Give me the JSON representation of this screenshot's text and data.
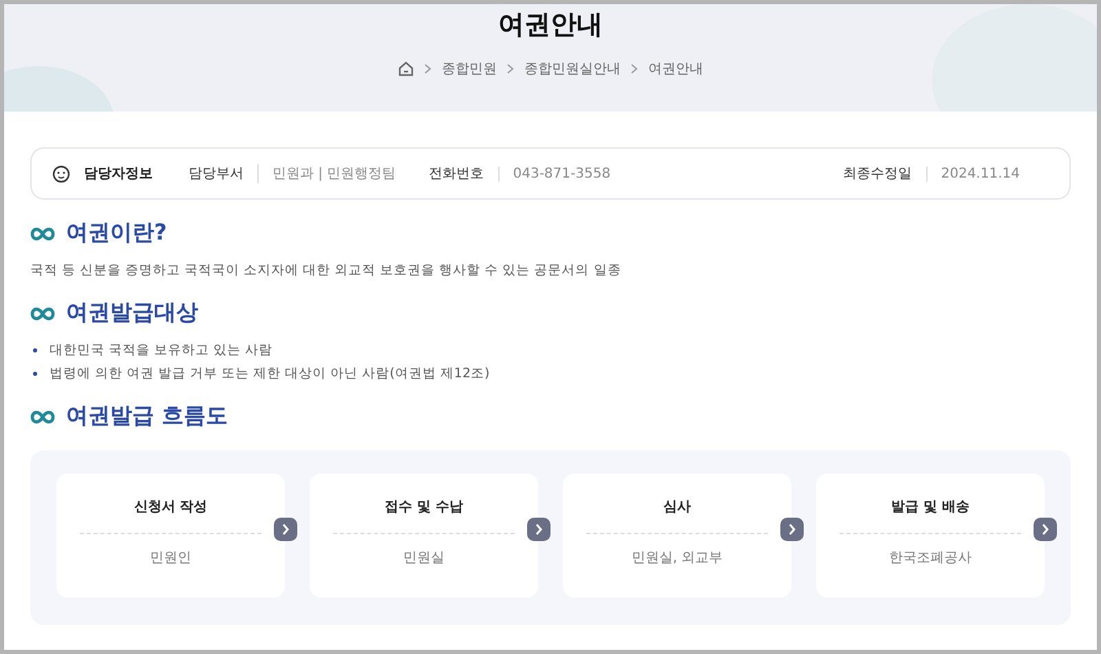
{
  "page_title": "여권안내",
  "breadcrumb": [
    "종합민원",
    "종합민원실안내",
    "여권안내"
  ],
  "info_bar": {
    "title": "담당자정보",
    "department_label": "담당부서",
    "department": "민원과 | 민원행정팀",
    "phone_label": "전화번호",
    "phone": "043-871-3558",
    "updated_label": "최종수정일",
    "updated": "2024.11.14"
  },
  "sections": [
    {
      "kind": "paragraph",
      "heading": "여권이란?",
      "text": "국적 등 신분을 증명하고 국적국이 소지자에 대한 외교적 보호권을 행사할 수 있는 공문서의 일종"
    },
    {
      "kind": "list",
      "heading": "여권발급대상",
      "items": [
        "대한민국 국적을 보유하고 있는 사람",
        "법령에 의한 여권 발급 거부 또는 제한 대상이 아닌 사람(여권법 제12조)"
      ]
    },
    {
      "kind": "flow",
      "heading": "여권발급 흐름도",
      "steps": [
        {
          "title": "신청서 작성",
          "actor": "민원인"
        },
        {
          "title": "접수 및 수납",
          "actor": "민원실"
        },
        {
          "title": "심사",
          "actor": "민원실, 외교부"
        },
        {
          "title": "발급 및 배송",
          "actor": "한국조폐공사"
        }
      ]
    }
  ]
}
